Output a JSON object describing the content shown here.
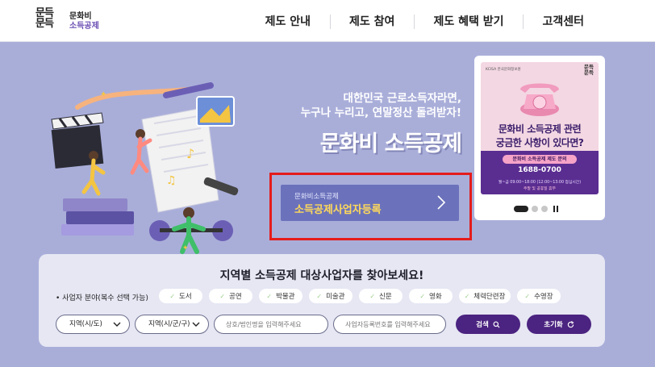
{
  "header": {
    "logo": {
      "script_line1": "문득",
      "script_line2": "문득",
      "text_line1": "문화비",
      "text_line2": "소득공제"
    },
    "nav": [
      "제도 안내",
      "제도 참여",
      "제도 혜택 받기",
      "고객센터"
    ]
  },
  "hero": {
    "tagline_line1": "대한민국 근로소득자라면,",
    "tagline_line2": "누구나 누리고, 연말정산 돌려받자!",
    "title": "문화비 소득공제",
    "register_small": "문화비소득공제",
    "register_label": "소득공제사업자등록"
  },
  "banner": {
    "org": "KCISA 한국문화정보원",
    "logo_line1": "문득",
    "logo_line2": "문득",
    "question_line1": "문화비 소득공제 관련",
    "question_line2": "궁금한 사항이 있다면?",
    "chip": "문화비 소득공제 제도 문의",
    "phone": "1688-0700",
    "hours": "월~금 09:00~18:00 (12:00~13:00 점심시간)",
    "hours2": "주말 및 공휴일 휴무",
    "slides_total": 3,
    "slide_active": 1
  },
  "search": {
    "title": "지역별 소득공제 대상사업자를 찾아보세요!",
    "field_label": "• 사업자 분야(복수 선택 가능)",
    "categories": [
      "도서",
      "공연",
      "박물관",
      "미술관",
      "신문",
      "영화",
      "체력단련장",
      "수영장"
    ],
    "region_select_1": "지역(시/도)",
    "region_select_2": "지역(시/군/구)",
    "name_placeholder": "상호/법인명을 입력해주세요",
    "number_placeholder": "사업자등록번호를 입력해주세요",
    "search_button": "검색",
    "reset_button": "초기화"
  },
  "colors": {
    "hero_bg": "#a9aed9",
    "register_bg": "#6b72bb",
    "register_text": "#ffd95a",
    "highlight": "#e41c1c",
    "primary_button": "#4b2380"
  }
}
